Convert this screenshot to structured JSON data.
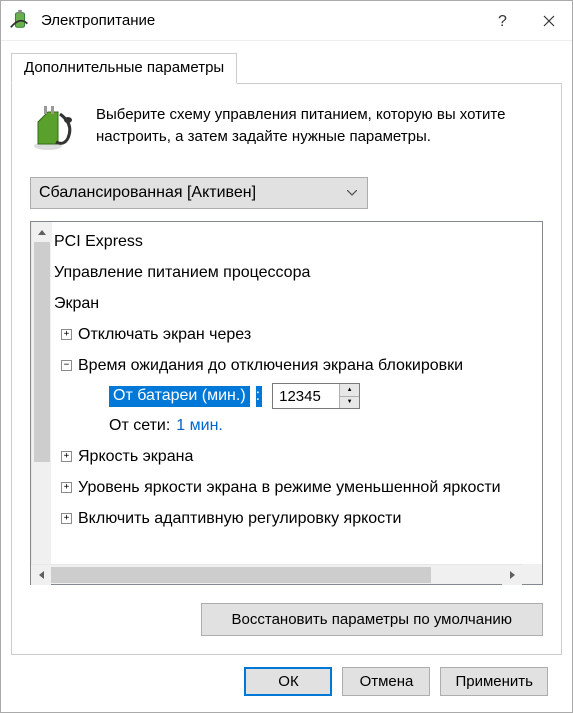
{
  "title": "Электропитание",
  "tab": "Дополнительные параметры",
  "intro": "Выберите схему управления питанием, которую вы хотите настроить, а затем задайте нужные параметры.",
  "scheme": "Сбалансированная [Активен]",
  "tree": {
    "pci": "PCI Express",
    "cpu": "Управление питанием процессора",
    "screen": "Экран",
    "off_after": "Отключать экран через",
    "lock_timeout": "Время ожидания до отключения экрана блокировки",
    "battery_label": "От батареи (мин.)",
    "battery_value": "12345",
    "plugged_label": "От сети:",
    "plugged_value": "1 мин.",
    "brightness": "Яркость экрана",
    "dim_brightness": "Уровень яркости экрана в режиме уменьшенной яркости",
    "adaptive": "Включить адаптивную регулировку яркости"
  },
  "restore": "Восстановить параметры по умолчанию",
  "buttons": {
    "ok": "ОК",
    "cancel": "Отмена",
    "apply": "Применить"
  }
}
